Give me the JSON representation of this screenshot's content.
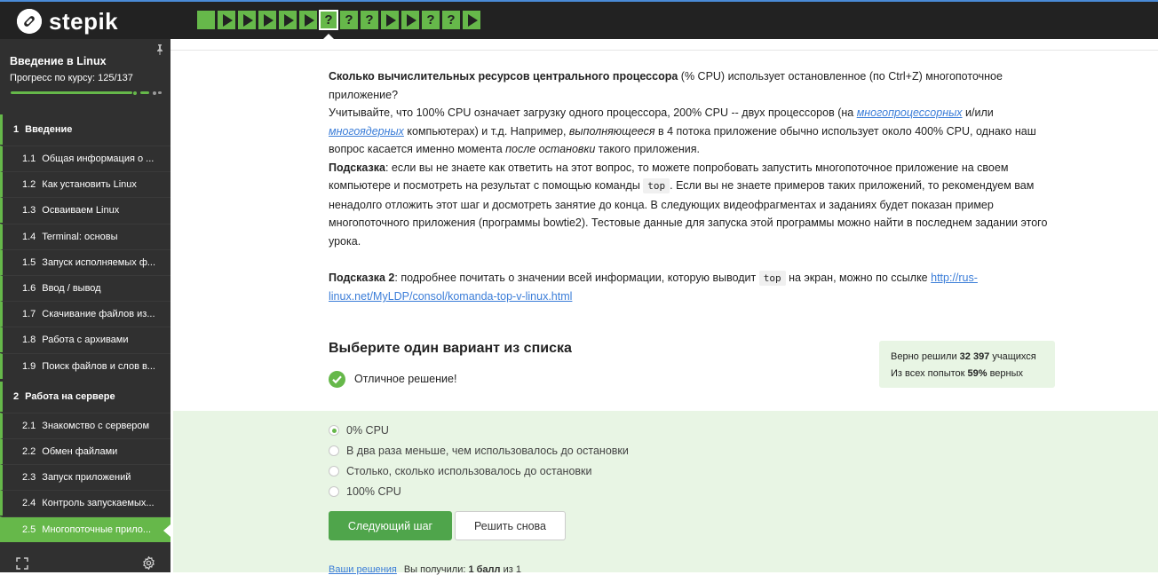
{
  "app": {
    "logo_text": "stepik"
  },
  "steps": [
    {
      "kind": "done"
    },
    {
      "kind": "play"
    },
    {
      "kind": "play"
    },
    {
      "kind": "play"
    },
    {
      "kind": "play"
    },
    {
      "kind": "play"
    },
    {
      "kind": "quiz",
      "current": true,
      "label": "?"
    },
    {
      "kind": "quiz",
      "label": "?"
    },
    {
      "kind": "quiz",
      "label": "?"
    },
    {
      "kind": "play"
    },
    {
      "kind": "play"
    },
    {
      "kind": "quiz",
      "label": "?"
    },
    {
      "kind": "quiz",
      "label": "?"
    },
    {
      "kind": "play"
    }
  ],
  "sidebar": {
    "course_title": "Введение в Linux",
    "progress_label": "Прогресс по курсу:",
    "progress_value": "125/137",
    "progress_fraction": 0.912,
    "sections": [
      {
        "number": "1",
        "title": "Введение",
        "lessons": [
          {
            "num": "1.1",
            "title": "Общая информация о ..."
          },
          {
            "num": "1.2",
            "title": "Как установить Linux"
          },
          {
            "num": "1.3",
            "title": "Осваиваем Linux"
          },
          {
            "num": "1.4",
            "title": "Terminal: основы"
          },
          {
            "num": "1.5",
            "title": "Запуск исполняемых ф..."
          },
          {
            "num": "1.6",
            "title": "Ввод / вывод"
          },
          {
            "num": "1.7",
            "title": "Скачивание файлов из..."
          },
          {
            "num": "1.8",
            "title": "Работа с архивами"
          },
          {
            "num": "1.9",
            "title": "Поиск файлов и слов в..."
          }
        ]
      },
      {
        "number": "2",
        "title": "Работа на сервере",
        "lessons": [
          {
            "num": "2.1",
            "title": "Знакомство с сервером"
          },
          {
            "num": "2.2",
            "title": "Обмен файлами"
          },
          {
            "num": "2.3",
            "title": "Запуск приложений"
          },
          {
            "num": "2.4",
            "title": "Контроль запускаемых..."
          },
          {
            "num": "2.5",
            "title": "Многопоточные прило...",
            "active": true
          }
        ]
      }
    ]
  },
  "question": {
    "p1_bold": "Сколько вычислительных ресурсов центрального процессора",
    "p1_rest": " (% CPU) использует остановленное (по Ctrl+Z) многопоточное приложение?",
    "p2_a": "Учитывайте, что 100% CPU означает загрузку одного процессора, 200% CPU -- двух процессоров (на ",
    "p2_link1": "многопроцессорных",
    "p2_b": " и/или ",
    "p2_link2": "многоядерных",
    "p2_c": " компьютерах) и т.д. Например, ",
    "p2_em1": "выполняющееся",
    "p2_d": " в 4 потока приложение обычно использует около 400% CPU, однако наш вопрос касается именно момента ",
    "p2_em2": "после остановки",
    "p2_e": " такого приложения.",
    "hint1_label": "Подсказка",
    "hint1_a": ": если вы не знаете как ответить на этот вопрос, то можете попробовать запустить многопоточное приложение на своем компьютере и посмотреть на результат с помощью команды ",
    "hint1_code": "top",
    "hint1_b": ". Если вы не знаете примеров таких приложений, то рекомендуем вам ненадолго отложить этот шаг и досмотреть занятие до конца. В следующих видеофрагментах и заданиях будет показан пример многопоточного приложения (программы bowtie2). Тестовые данные для запуска этой программы можно найти в последнем задании этого урока.",
    "hint2_label": "Подсказка 2",
    "hint2_a": ": подробнее почитать о значении всей информации, которую выводит ",
    "hint2_code": "top",
    "hint2_b": " на экран, можно по ссылке ",
    "hint2_link": "http://rus-linux.net/MyLDP/consol/komanda-top-v-linux.html"
  },
  "quiz": {
    "choose_title": "Выберите один вариант из списка",
    "result_text": "Отличное решение!",
    "stats_line1_a": "Верно решили ",
    "stats_line1_num": "32 397",
    "stats_line1_b": " учащихся",
    "stats_line2_a": "Из всех попыток ",
    "stats_line2_num": "59%",
    "stats_line2_b": " верных",
    "options": [
      {
        "label": "0% CPU",
        "selected": true
      },
      {
        "label": "В два раза меньше, чем использовалось до остановки",
        "selected": false
      },
      {
        "label": "Столько, сколько использовалось до остановки",
        "selected": false
      },
      {
        "label": "100% CPU",
        "selected": false
      }
    ],
    "next_label": "Следующий шаг",
    "retry_label": "Решить снова",
    "solutions_link": "Ваши решения",
    "score_a": "Вы получили: ",
    "score_bold": "1 балл",
    "score_b": " из 1"
  },
  "colors": {
    "accent": "#66b84a",
    "topbar": "#222222",
    "sidebar": "#303030",
    "answer_bg": "#e8f5e4",
    "link": "#3b7dd8"
  },
  "icons": {
    "pin": "pin-icon",
    "expand": "expand-icon",
    "settings": "gear-icon",
    "correct": "check-circle-icon"
  }
}
